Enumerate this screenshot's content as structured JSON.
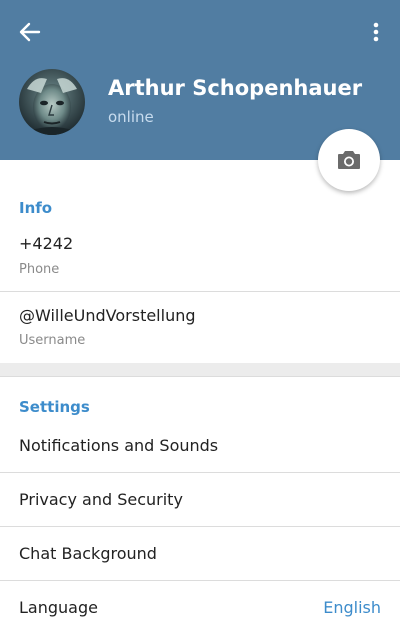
{
  "header": {
    "background_color": "#517da2",
    "back_icon": "arrow-left-icon",
    "menu_icon": "vertical-dots-icon"
  },
  "profile": {
    "name": "Arthur Schopenhauer",
    "status": "online",
    "camera_icon": "camera-icon"
  },
  "info": {
    "title": "Info",
    "phone_value": "+4242",
    "phone_label": "Phone",
    "username_value": "@WilleUndVorstellung",
    "username_label": "Username"
  },
  "settings": {
    "title": "Settings",
    "notifications_label": "Notifications and Sounds",
    "privacy_label": "Privacy and Security",
    "chat_background_label": "Chat Background",
    "language_label": "Language",
    "language_value": "English"
  },
  "colors": {
    "accent": "#3d8ccb",
    "header": "#517da2"
  }
}
